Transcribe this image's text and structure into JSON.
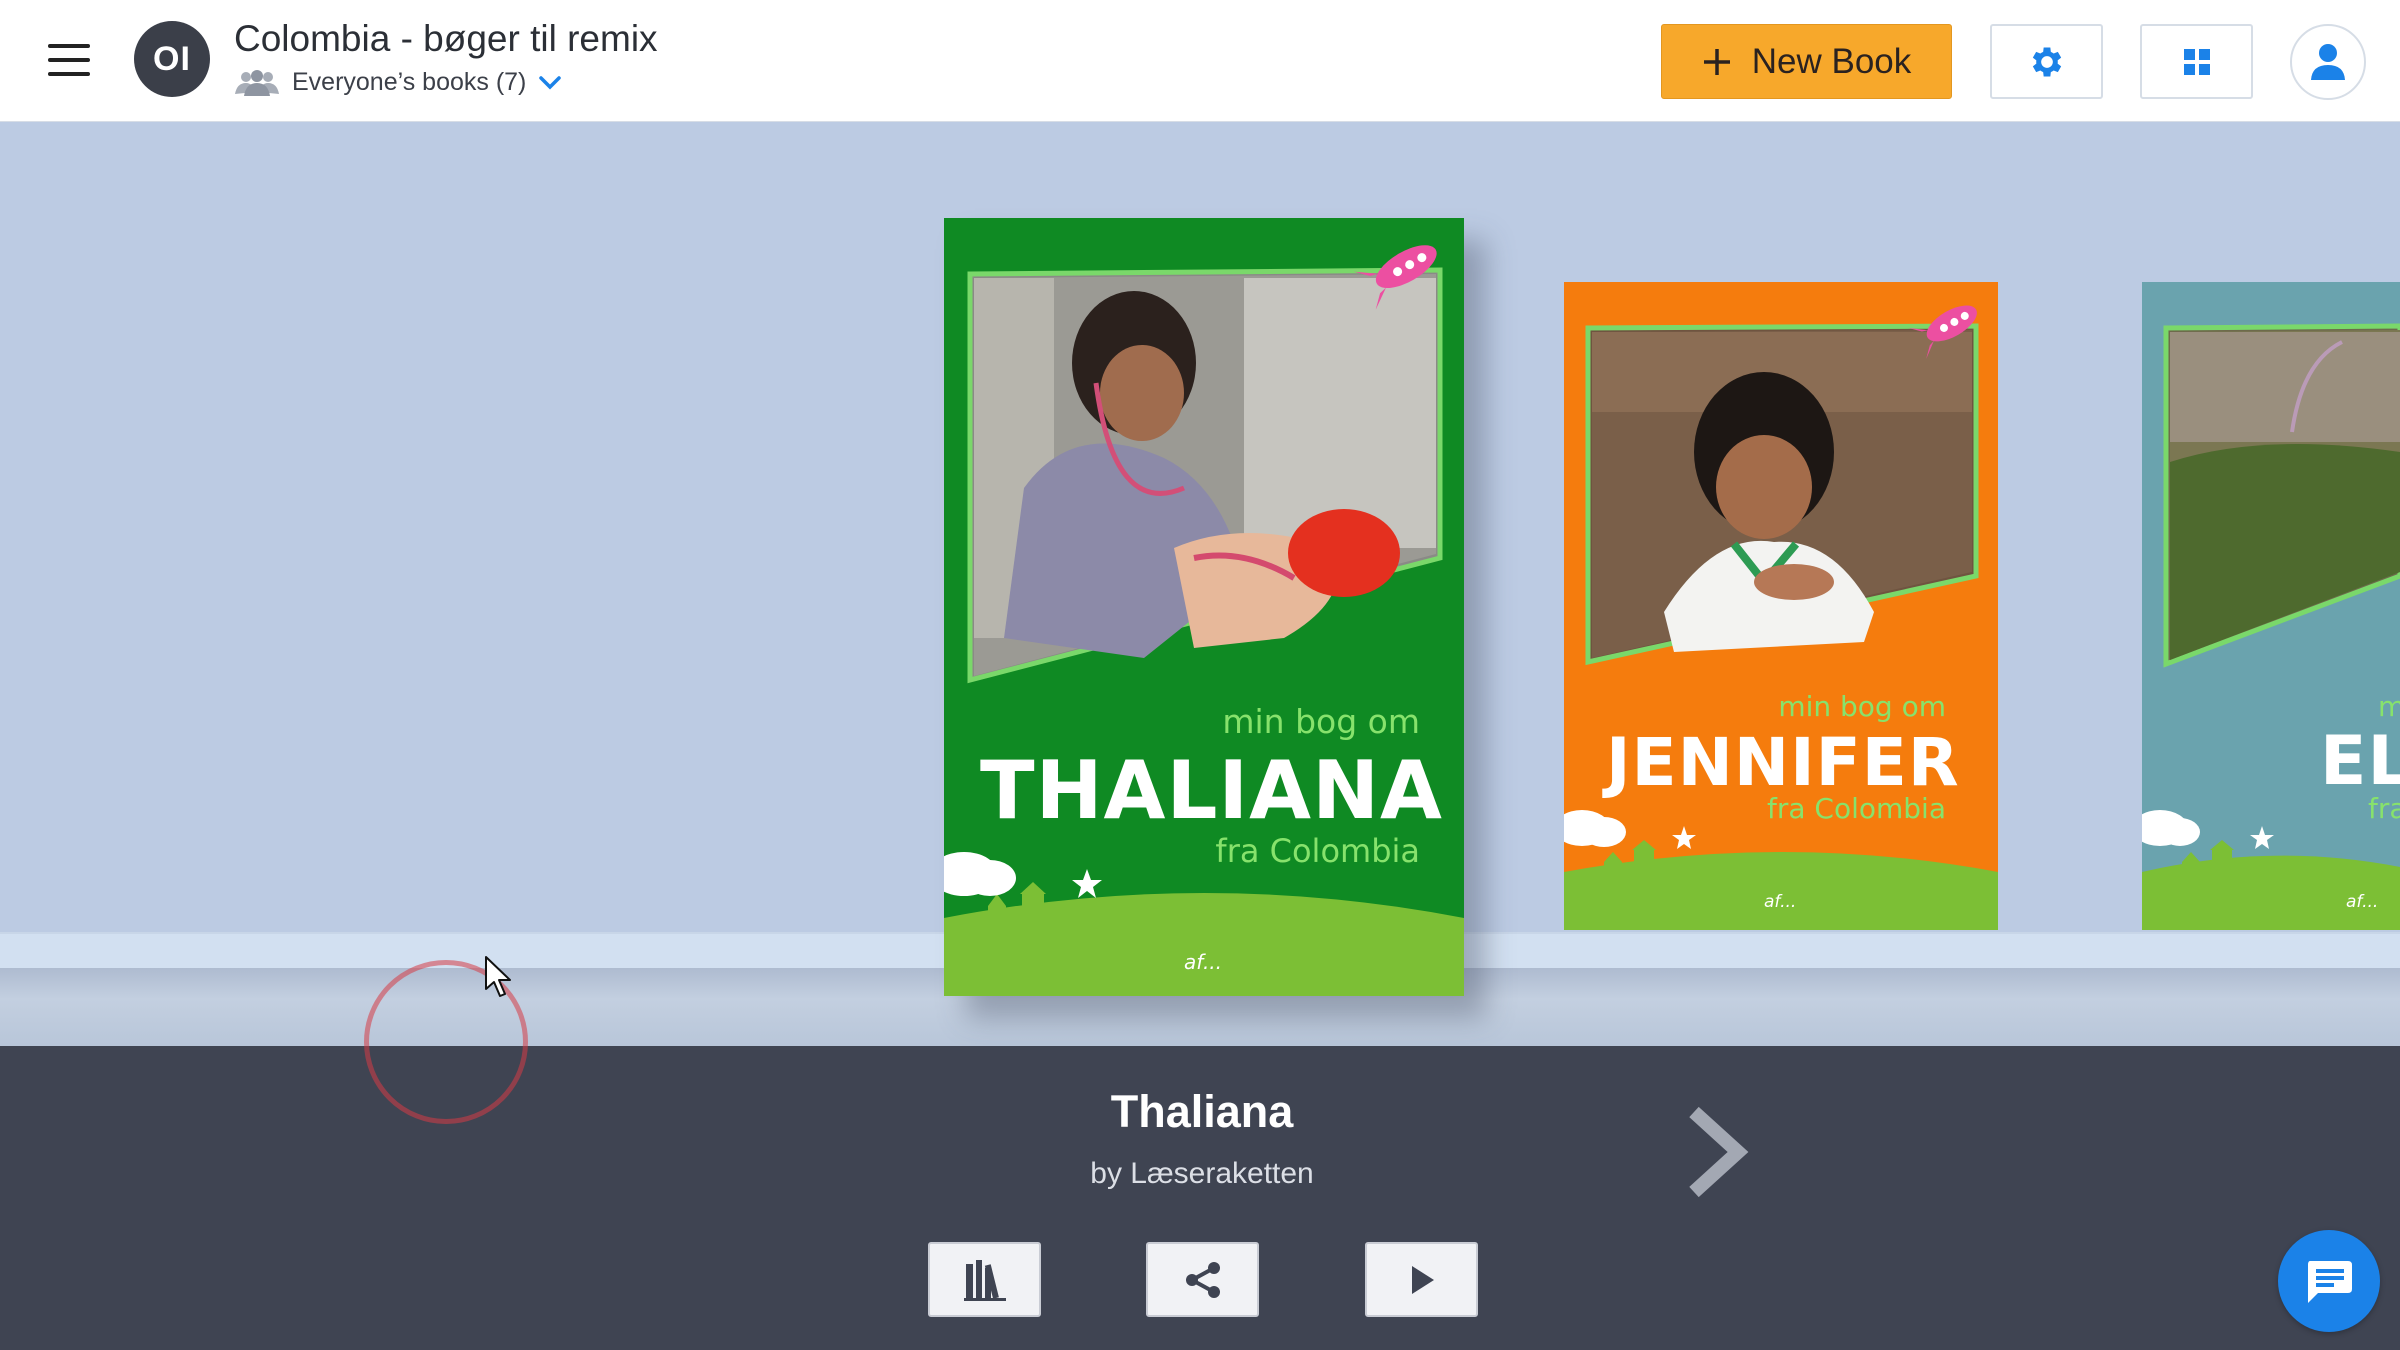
{
  "header": {
    "avatar_initials": "OI",
    "library_title": "Colombia - bøger til remix",
    "filter_label": "Everyone’s books (7)",
    "new_book_label": "New Book",
    "icons": [
      "menu-icon",
      "people-icon",
      "chevron-down-icon",
      "plus-icon",
      "gear-icon",
      "grid-icon",
      "user-icon"
    ]
  },
  "books": [
    {
      "subtitle": "min bog om",
      "name": "THALIANA",
      "place": "fra Colombia",
      "author_line": "af...",
      "cover_color": "#0f8a23"
    },
    {
      "subtitle": "min bog om",
      "name": "JENNIFER",
      "place": "fra Colombia",
      "author_line": "af...",
      "cover_color": "#f57c0d"
    },
    {
      "subtitle": "m",
      "name": "EL",
      "place": "fra",
      "author_line": "af...",
      "cover_color": "#6aa3ae"
    }
  ],
  "selected_book": {
    "title": "Thaliana",
    "author": "by Læseraketten"
  },
  "actions": {
    "icons": [
      "library-icon",
      "share-icon",
      "play-icon",
      "next-arrow-icon",
      "chat-icon"
    ]
  },
  "colors": {
    "accent_orange": "#f7a82b",
    "brand_blue": "#1b82e8",
    "panel_dark": "#3f4452",
    "shelf_bg": "#bccbe3"
  }
}
